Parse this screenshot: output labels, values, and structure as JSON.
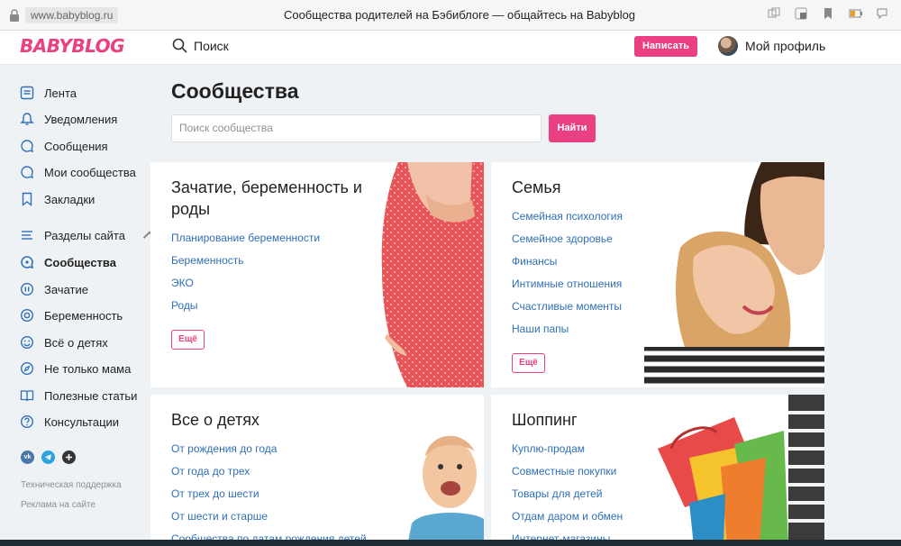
{
  "browser": {
    "url": "www.babyblog.ru",
    "title": "Сообщества родителей на Бэбиблоге — общайтесь на Babyblog"
  },
  "header": {
    "logo": "BABYBLOG",
    "search_label": "Поиск",
    "write_button": "Написать",
    "profile_label": "Мой профиль"
  },
  "sidebar": {
    "items": [
      {
        "label": "Лента",
        "icon": "feed-icon"
      },
      {
        "label": "Уведомления",
        "icon": "bell-icon"
      },
      {
        "label": "Сообщения",
        "icon": "chat-icon"
      },
      {
        "label": "Мои сообщества",
        "icon": "chat-icon"
      },
      {
        "label": "Закладки",
        "icon": "bookmark-icon"
      },
      {
        "label": "Разделы сайта",
        "icon": "menu-icon"
      },
      {
        "label": "Сообщества",
        "icon": "communities-icon"
      },
      {
        "label": "Зачатие",
        "icon": "conception-icon"
      },
      {
        "label": "Беременность",
        "icon": "pregnancy-icon"
      },
      {
        "label": "Всё о детях",
        "icon": "smile-icon"
      },
      {
        "label": "Не только мама",
        "icon": "compass-icon"
      },
      {
        "label": "Полезные статьи",
        "icon": "book-icon"
      },
      {
        "label": "Консультации",
        "icon": "question-icon"
      }
    ],
    "socials": [
      "vk",
      "telegram",
      "ok"
    ],
    "footer": {
      "support": "Техническая поддержка",
      "ads": "Реклама на сайте"
    }
  },
  "main": {
    "title": "Сообщества",
    "search_placeholder": "Поиск сообщества",
    "find_button": "Найти",
    "cards": [
      {
        "title": "Зачатие, беременность и роды",
        "links": [
          "Планирование беременности",
          "Беременность",
          "ЭКО",
          "Роды"
        ],
        "more": "Ещё"
      },
      {
        "title": "Семья",
        "links": [
          "Семейная психология",
          "Семейное здоровье",
          "Финансы",
          "Интимные отношения",
          "Счастливые моменты",
          "Наши папы"
        ],
        "more": "Ещё"
      },
      {
        "title": "Все о детях",
        "links": [
          "От рождения до года",
          "От года до трех",
          "От трех до шести",
          "От шести и старше",
          "Сообщества по датам рождения детей"
        ]
      },
      {
        "title": "Шоппинг",
        "links": [
          "Куплю-продам",
          "Совместные покупки",
          "Товары для детей",
          "Отдам даром и обмен",
          "Интернет-магазины"
        ]
      }
    ]
  },
  "colors": {
    "accent": "#ea3f80",
    "link": "#2f6fb6",
    "page_bg": "#eef2f4"
  }
}
